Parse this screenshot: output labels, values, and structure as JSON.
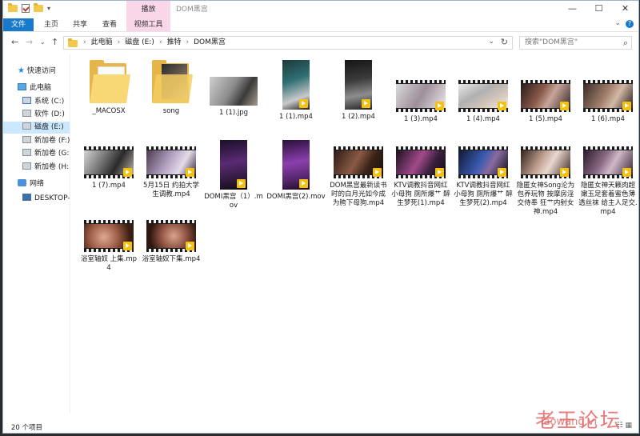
{
  "window": {
    "title": "DOM黑宫",
    "context_tab": "播放",
    "controls": [
      "—",
      "☐",
      "✕"
    ]
  },
  "ribbon": {
    "tabs": [
      "文件",
      "主页",
      "共享",
      "查看",
      "视频工具"
    ]
  },
  "address": {
    "crumbs": [
      "此电脑",
      "磁盘 (E:)",
      "推特",
      "DOM黑宫"
    ],
    "search_placeholder": "搜索\"DOM黑宫\""
  },
  "sidebar": {
    "items": [
      {
        "label": "快速访问",
        "icon": "star-icon"
      },
      {
        "label": "此电脑",
        "icon": "pc-icon"
      },
      {
        "label": "系统 (C:)",
        "icon": "drive-icon"
      },
      {
        "label": "软件 (D:)",
        "icon": "drive-icon"
      },
      {
        "label": "磁盘 (E:)",
        "icon": "drive-icon",
        "selected": true
      },
      {
        "label": "新加卷 (F:)",
        "icon": "drive-icon"
      },
      {
        "label": "新加卷 (G:)",
        "icon": "drive-icon"
      },
      {
        "label": "新加卷 (H:)",
        "icon": "drive-icon"
      },
      {
        "label": "网络",
        "icon": "network-icon"
      },
      {
        "label": "DESKTOP-(",
        "icon": "computer-icon"
      }
    ]
  },
  "files": [
    {
      "name": "_MACOSX",
      "kind": "folder"
    },
    {
      "name": "song",
      "kind": "folder-photo"
    },
    {
      "name": "1 (1).jpg",
      "kind": "image"
    },
    {
      "name": "1 (1).mp4",
      "kind": "video-portrait"
    },
    {
      "name": "1 (2).mp4",
      "kind": "video-portrait"
    },
    {
      "name": "1 (3).mp4",
      "kind": "video-strip"
    },
    {
      "name": "1 (4).mp4",
      "kind": "video-strip"
    },
    {
      "name": "1 (5).mp4",
      "kind": "video-strip"
    },
    {
      "name": "1 (6).mp4",
      "kind": "video-strip"
    },
    {
      "name": "1 (7).mp4",
      "kind": "video-strip"
    },
    {
      "name": "5月15日 约拍大学生调教.mp4",
      "kind": "video-strip"
    },
    {
      "name": "DOMI黑宫（1）.mov",
      "kind": "video-portrait"
    },
    {
      "name": "DOMI黑宫(2).mov",
      "kind": "video-portrait"
    },
    {
      "name": "DOM黑宫最新读书时的白月光如今成为胯下母狗.mp4",
      "kind": "video-strip"
    },
    {
      "name": "KTV调教抖音网红小母狗 厕所爆艹 醉生梦死(1).mp4",
      "kind": "video-strip"
    },
    {
      "name": "KTV调教抖音网红小母狗 厕所爆艹 醉生梦死(2).mp4",
      "kind": "video-strip"
    },
    {
      "name": "隐匿女神Song沦为包养玩物 按摩房淫交侍奉 狂艹内射女神.mp4",
      "kind": "video-strip"
    },
    {
      "name": "隐匿女神天籁肉超嫩玉足套着蜜色薄透丝袜 给主人足交.mp4",
      "kind": "video-strip"
    },
    {
      "name": "浴室轴奴 上集.mp4",
      "kind": "video-strip"
    },
    {
      "name": "浴室轴奴下集.mp4",
      "kind": "video-strip"
    }
  ],
  "status": {
    "count": "20 个项目"
  },
  "watermark": {
    "cn": "老王论坛",
    "en": "laowang.vi"
  }
}
